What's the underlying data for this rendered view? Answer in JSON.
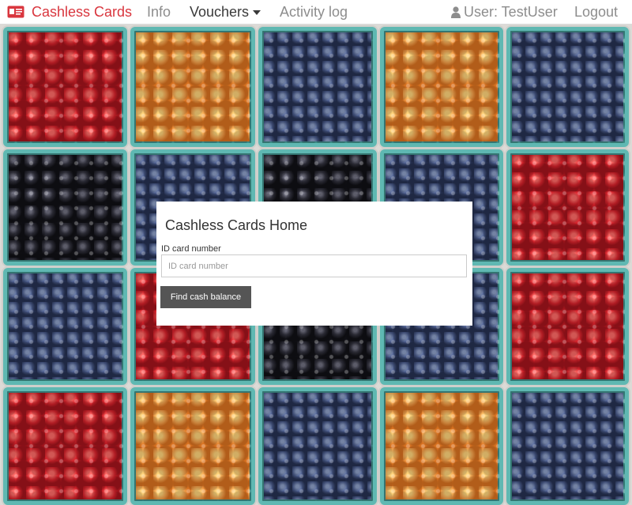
{
  "navbar": {
    "brand_label": "Cashless Cards",
    "brand_icon": "id-card-icon",
    "links": {
      "info": "Info",
      "vouchers": "Vouchers",
      "activity_log": "Activity log"
    },
    "user_label": "User: TestUser",
    "user_icon": "user-icon",
    "logout": "Logout",
    "colors": {
      "brand": "#d9363e",
      "link": "#8d8d8d",
      "active_link": "#3a3a3a"
    }
  },
  "background": {
    "description_icon": "berry-baskets-photo"
  },
  "card": {
    "title": "Cashless Cards Home",
    "field_label": "ID card number",
    "input_value": "",
    "input_placeholder": "ID card number",
    "button_label": "Find cash balance",
    "button_color": "#555555"
  }
}
